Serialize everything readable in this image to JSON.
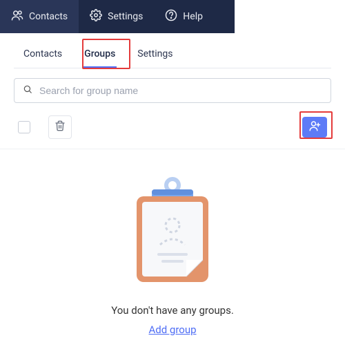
{
  "topbar": {
    "contacts": "Contacts",
    "settings": "Settings",
    "help": "Help"
  },
  "tabs": {
    "contacts": "Contacts",
    "groups": "Groups",
    "settings": "Settings"
  },
  "search": {
    "placeholder": "Search for group name",
    "value": ""
  },
  "empty": {
    "message": "You don't have any groups.",
    "link": "Add group"
  },
  "colors": {
    "accent": "#5d7bf7",
    "highlight": "#e43b3b"
  }
}
